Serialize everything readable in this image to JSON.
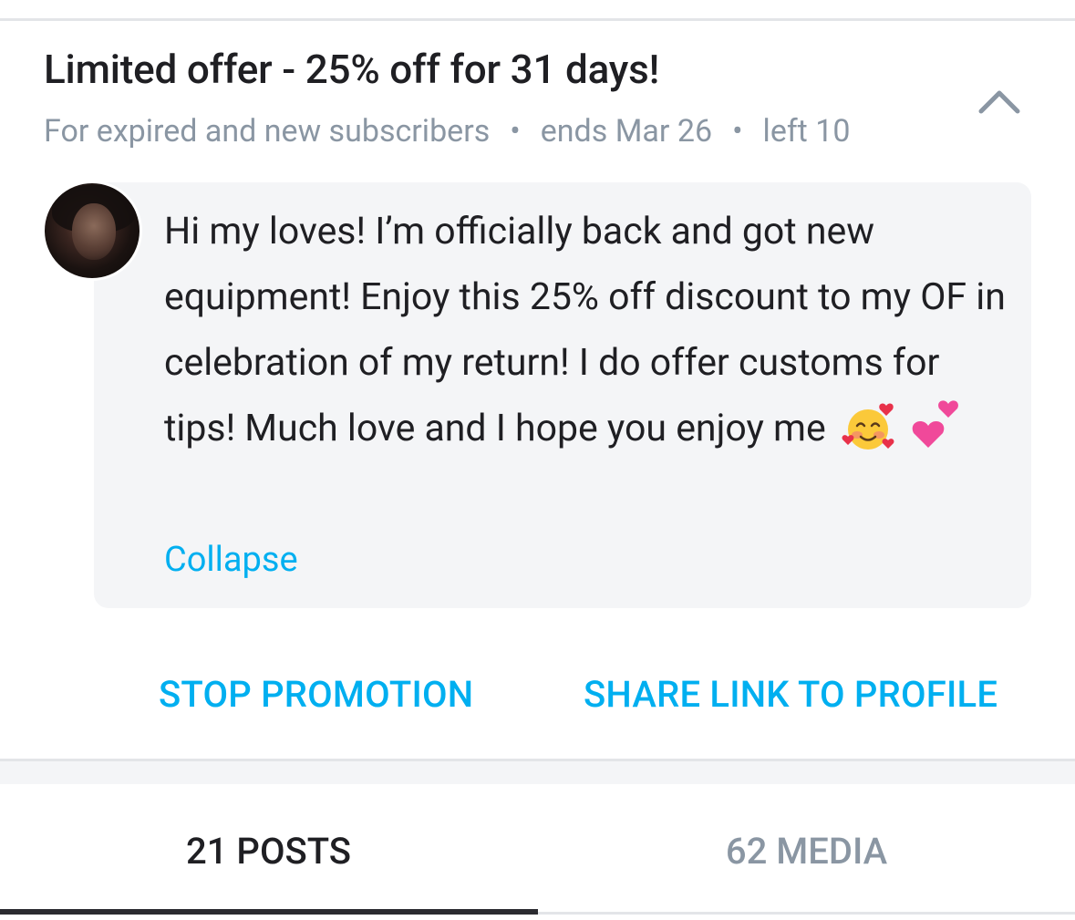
{
  "offer": {
    "title": "Limited offer - 25% off for 31 days!",
    "audience": "For expired and new subscribers",
    "ends": "ends Mar 26",
    "left": "left 10",
    "separator": "•"
  },
  "message": {
    "text": "Hi my loves! I’m officially back and got new equipment! Enjoy this 25% off discount to my OF in celebration of my return! I do of­fer customs for tips! Much love and I hope you enjoy me",
    "emoji_1": "smiling-face-with-hearts",
    "emoji_2": "two-hearts",
    "collapse_label": "Collapse"
  },
  "actions": {
    "stop_label": "STOP PROMOTION",
    "share_label": "SHARE LINK TO PROFILE"
  },
  "tabs": [
    {
      "label": "21 POSTS",
      "active": true
    },
    {
      "label": "62 MEDIA",
      "active": false
    }
  ],
  "colors": {
    "accent": "#00aff0",
    "text": "#1f1f23",
    "muted": "#8a96a3",
    "bubble": "#f4f5f7"
  }
}
